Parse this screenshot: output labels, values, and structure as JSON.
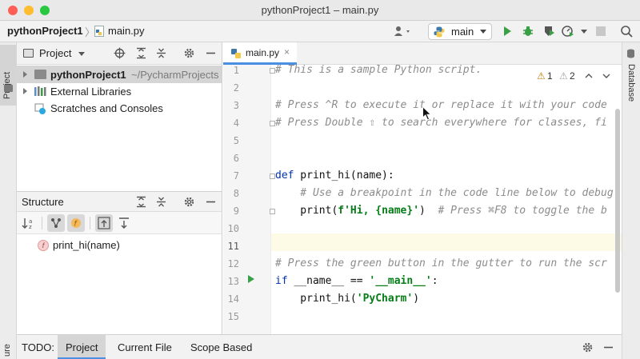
{
  "window": {
    "title": "pythonProject1 – main.py"
  },
  "navbar": {
    "project": "pythonProject1",
    "separator": "〉",
    "file": "main.py",
    "run_config": "main"
  },
  "left_strip": {
    "project_tab": "Project",
    "structure_tab": "ure"
  },
  "project_panel": {
    "header": "Project",
    "root": {
      "name": "pythonProject1",
      "path": "~/PycharmProjects"
    },
    "items": [
      "External Libraries",
      "Scratches and Consoles"
    ]
  },
  "structure_panel": {
    "header": "Structure",
    "items": [
      {
        "icon": "f",
        "label": "print_hi(name)"
      }
    ]
  },
  "editor": {
    "tab": "main.py",
    "tab_close": "×",
    "inspections": {
      "warnings": "1",
      "weak_warnings": "2"
    },
    "lines": [
      {
        "n": "1",
        "text": "# This is a sample Python script."
      },
      {
        "n": "2",
        "text": ""
      },
      {
        "n": "3",
        "text": "# Press ^R to execute it or replace it with your code"
      },
      {
        "n": "4",
        "text": "# Press Double ⇧ to search everywhere for classes, fi"
      },
      {
        "n": "5",
        "text": ""
      },
      {
        "n": "6",
        "text": ""
      },
      {
        "n": "7",
        "text": "def print_hi(name):"
      },
      {
        "n": "8",
        "text": "    # Use a breakpoint in the code line below to debug"
      },
      {
        "n": "9",
        "text": "    print(f'Hi, {name}')  # Press ⌘F8 to toggle the b"
      },
      {
        "n": "10",
        "text": ""
      },
      {
        "n": "11",
        "text": ""
      },
      {
        "n": "12",
        "text": "# Press the green button in the gutter to run the scr"
      },
      {
        "n": "13",
        "text": "if __name__ == '__main__':"
      },
      {
        "n": "14",
        "text": "    print_hi('PyCharm')"
      },
      {
        "n": "15",
        "text": ""
      }
    ],
    "code_parts": {
      "def_kw": "def",
      "def_rest": " print_hi(name):",
      "l9_indent": "    print(",
      "l9_str": "f'Hi, {name}'",
      "l9_close": ")  ",
      "l9_comment": "# Press ⌘F8 to toggle the b",
      "l13_kw": "if",
      "l13_mid": " __name__ == ",
      "l13_str": "'__main__'",
      "l13_end": ":",
      "l14_a": "    print_hi(",
      "l14_str": "'PyCharm'",
      "l14_b": ")"
    }
  },
  "right_strip": {
    "database_tab": "Database"
  },
  "todo_bar": {
    "label": "TODO:",
    "tabs": [
      "Project",
      "Current File",
      "Scope Based"
    ]
  },
  "colors": {
    "accent": "#4b8fe2",
    "run_green": "#3aa047",
    "comment": "#8c8c8c",
    "keyword": "#0033b3",
    "string": "#067d17"
  }
}
